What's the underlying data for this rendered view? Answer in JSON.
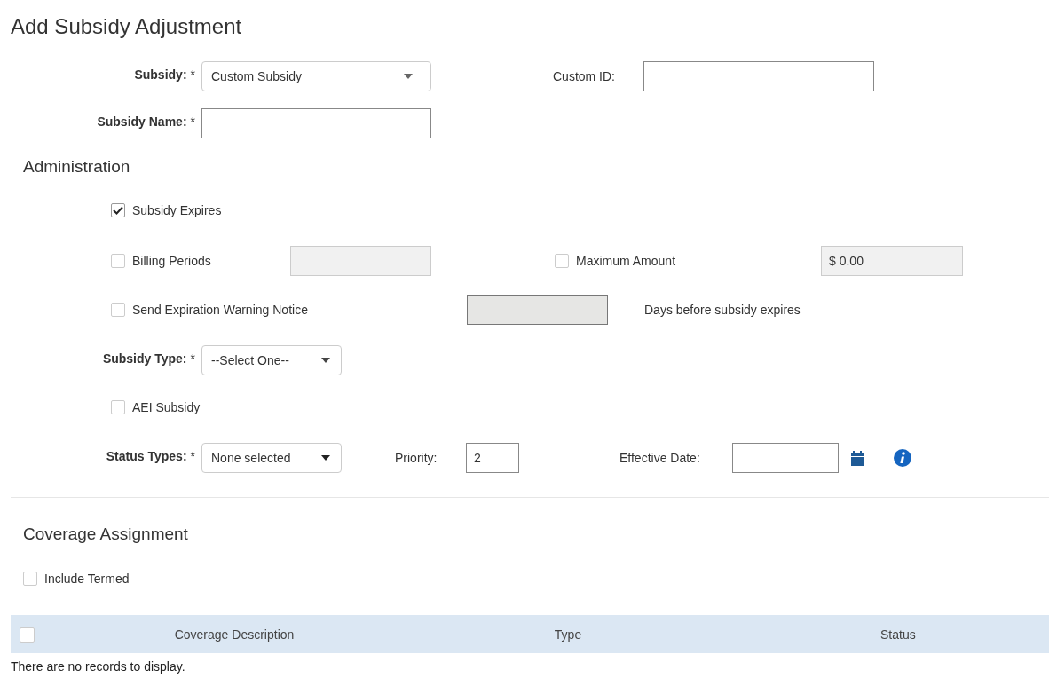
{
  "title": "Add Subsidy Adjustment",
  "subsidy": {
    "label": "Subsidy:",
    "required_mark": "*",
    "value": "Custom Subsidy"
  },
  "custom_id": {
    "label": "Custom ID:"
  },
  "subsidy_name": {
    "label": "Subsidy Name:",
    "required_mark": "*"
  },
  "administration": {
    "heading": "Administration",
    "subsidy_expires": {
      "label": "Subsidy Expires",
      "checked": true
    },
    "billing_periods": {
      "label": "Billing Periods",
      "checked": false,
      "input_disabled": true
    },
    "maximum_amount": {
      "label": "Maximum Amount",
      "checked": false,
      "input_disabled": true,
      "value": "$ 0.00"
    },
    "expiration_warning": {
      "label": "Send Expiration Warning Notice",
      "checked": false,
      "input_disabled": true,
      "suffix": "Days before subsidy expires"
    },
    "subsidy_type": {
      "label": "Subsidy Type:",
      "required_mark": "*",
      "value": "--Select One--"
    },
    "aei_subsidy": {
      "label": "AEI Subsidy",
      "checked": false
    },
    "status_types": {
      "label": "Status Types:",
      "required_mark": "*",
      "value": "None selected"
    },
    "priority": {
      "label": "Priority:",
      "value": "2"
    },
    "effective_date": {
      "label": "Effective Date:"
    }
  },
  "coverage": {
    "heading": "Coverage Assignment",
    "include_termed": {
      "label": "Include Termed",
      "checked": false
    },
    "table": {
      "select_all_checked": false,
      "columns": [
        "Coverage Description",
        "Type",
        "Status"
      ],
      "empty_message": "There are no records to display."
    }
  }
}
